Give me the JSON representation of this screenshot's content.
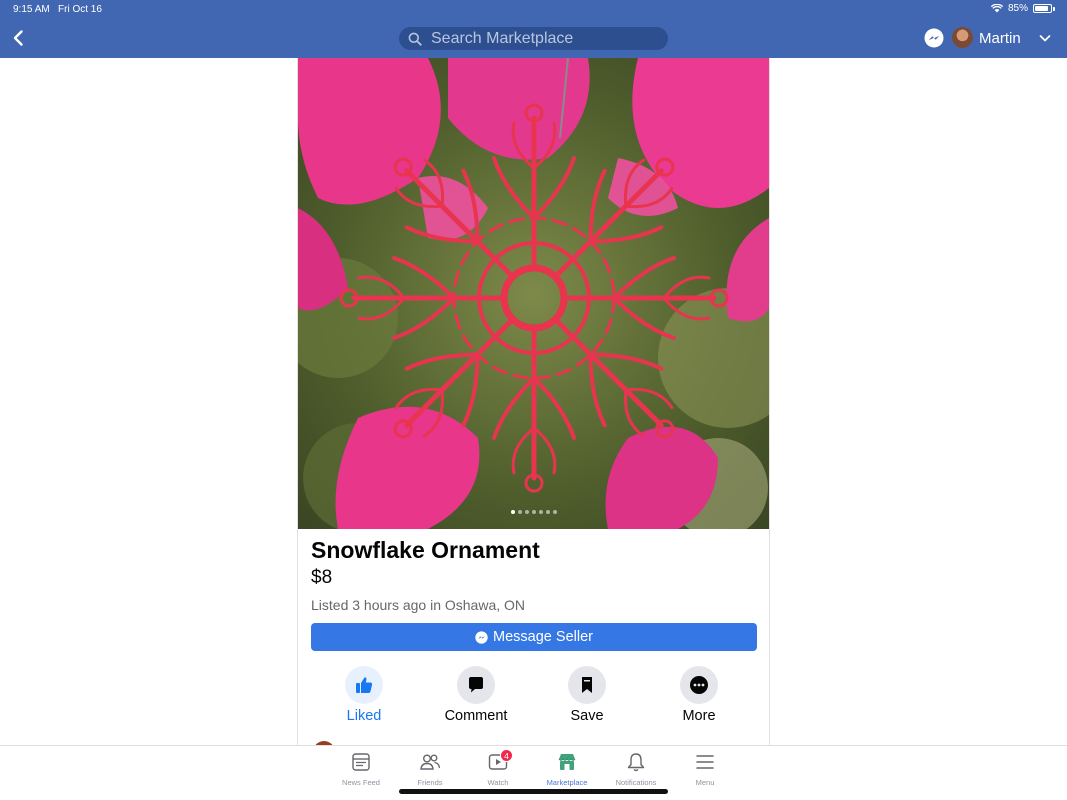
{
  "status_bar": {
    "time": "9:15 AM",
    "date": "Fri Oct 16",
    "battery": "85%",
    "battery_level": 0.85
  },
  "header": {
    "search_placeholder": "Search Marketplace",
    "user_name": "Martin",
    "icons": [
      "back-chevron-icon",
      "search-icon",
      "messenger-icon",
      "chevron-down-icon"
    ]
  },
  "listing": {
    "title": "Snowflake Ornament",
    "price": "$8",
    "meta": "Listed 3 hours ago in Oshawa, ON",
    "message_button": "Message Seller",
    "photo_count": 7,
    "photo_index": 0
  },
  "actions": [
    {
      "label": "Liked",
      "icon": "thumbs-up-icon",
      "active": true
    },
    {
      "label": "Comment",
      "icon": "comment-icon",
      "active": false
    },
    {
      "label": "Save",
      "icon": "bookmark-icon",
      "active": false
    },
    {
      "label": "More",
      "icon": "more-icon",
      "active": false
    }
  ],
  "tabs": [
    {
      "label": "News Feed",
      "icon": "news-feed-icon"
    },
    {
      "label": "Friends",
      "icon": "friends-icon"
    },
    {
      "label": "Watch",
      "icon": "watch-icon",
      "badge": "4"
    },
    {
      "label": "Marketplace",
      "icon": "marketplace-icon",
      "active": true
    },
    {
      "label": "Notifications",
      "icon": "bell-icon"
    },
    {
      "label": "Menu",
      "icon": "menu-icon"
    }
  ],
  "colors": {
    "header_bg": "#4267b2",
    "accent": "#3578e5",
    "liked": "#1877f2",
    "ornament": "#e8344f",
    "flower": "#e8368a"
  }
}
